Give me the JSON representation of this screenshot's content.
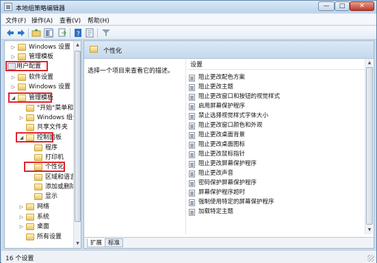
{
  "window": {
    "title": "本地组策略编辑器",
    "min": "—",
    "max": "□",
    "close": "✕"
  },
  "menu": [
    "文件(F)",
    "操作(A)",
    "查看(V)",
    "帮助(H)"
  ],
  "toolbar": {
    "icons": [
      "back-arrow-icon",
      "forward-arrow-icon",
      "up-folder-icon",
      "show-hide-tree-icon",
      "export-list-icon",
      "help-book-icon",
      "properties-icon",
      "filter-icon"
    ]
  },
  "tree": {
    "items": [
      {
        "label": "Windows 设置",
        "toggle": "▷",
        "depth": 1
      },
      {
        "label": "管理模板",
        "toggle": "▷",
        "depth": 1
      },
      {
        "label": "用户配置",
        "toggle": "",
        "depth": 0
      },
      {
        "label": "软件设置",
        "toggle": "▷",
        "depth": 1
      },
      {
        "label": "Windows 设置",
        "toggle": "▷",
        "depth": 1
      },
      {
        "label": "管理模板",
        "toggle": "◢",
        "depth": 1
      },
      {
        "label": "\"开始\"菜单和",
        "toggle": "",
        "depth": 2
      },
      {
        "label": "Windows 组件",
        "toggle": "▷",
        "depth": 2
      },
      {
        "label": "共享文件夹",
        "toggle": "",
        "depth": 2
      },
      {
        "label": "控制面板",
        "toggle": "◢",
        "depth": 2
      },
      {
        "label": "程序",
        "toggle": "",
        "depth": 3
      },
      {
        "label": "打印机",
        "toggle": "",
        "depth": 3
      },
      {
        "label": "个性化",
        "toggle": "",
        "depth": 3
      },
      {
        "label": "区域和语言",
        "toggle": "",
        "depth": 3
      },
      {
        "label": "添加或删除",
        "toggle": "",
        "depth": 3
      },
      {
        "label": "显示",
        "toggle": "",
        "depth": 3
      },
      {
        "label": "网络",
        "toggle": "▷",
        "depth": 2
      },
      {
        "label": "系统",
        "toggle": "▷",
        "depth": 2
      },
      {
        "label": "桌面",
        "toggle": "▷",
        "depth": 2
      },
      {
        "label": "所有设置",
        "toggle": "",
        "depth": 2
      }
    ]
  },
  "panel": {
    "title": "个性化",
    "description": "选择一个项目来查看它的描述。",
    "column_header": "设置",
    "settings": [
      "阻止更改配色方案",
      "阻止更改主题",
      "阻止更改窗口和按钮的视觉样式",
      "启用屏幕保护程序",
      "禁止选择视觉样式字体大小",
      "阻止更改窗口颜色和外观",
      "阻止更改桌面背景",
      "阻止更改桌面图标",
      "阻止更改鼠标指针",
      "阻止更改屏幕保护程序",
      "阻止更改声音",
      "密码保护屏幕保护程序",
      "屏幕保护程序超时",
      "强制使用特定的屏幕保护程序",
      "加载特定主题"
    ],
    "tabs": [
      "扩展",
      "标准"
    ]
  },
  "status": "16 个设置",
  "accent_red": "#e0202a"
}
